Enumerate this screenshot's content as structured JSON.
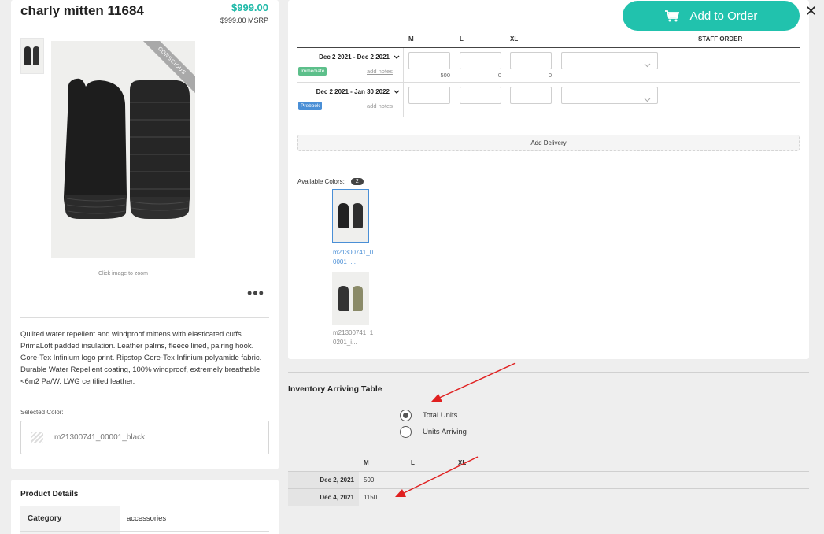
{
  "product": {
    "title": "charly mitten 11684",
    "price": "$999.00",
    "msrp": "$999.00 MSRP",
    "ribbon": "CONSCIOUS",
    "zoom_hint": "Click image to zoom",
    "more": "•••",
    "description": "Quilted water repellent and windproof mittens with elasticated cuffs. PrimaLoft padded insulation. Leather palms, fleece lined, pairing hook. Gore-Tex Infinium logo print. Ripstop Gore-Tex Infinium polyamide fabric. Durable Water Repellent coating, 100% windproof, extremely breathable <6m2 Pa/W. LWG certified leather.",
    "selected_color_label": "Selected Color:",
    "selected_color_value": "m21300741_00001_black"
  },
  "details": {
    "title": "Product Details",
    "rows": [
      {
        "key": "Category",
        "value": "accessories"
      }
    ]
  },
  "order": {
    "add_button": "Add to Order",
    "close": "✕",
    "sizes": [
      "M",
      "L",
      "XL"
    ],
    "staff_order_label": "STAFF ORDER",
    "deliveries": [
      {
        "date_range": "Dec 2 2021 - Dec 2 2021",
        "type": "Immediate",
        "notes": "add notes",
        "available": [
          "500",
          "0",
          "0"
        ]
      },
      {
        "date_range": "Dec 2 2021 - Jan 30 2022",
        "type": "Prebook",
        "notes": "add notes",
        "available": [
          "",
          "",
          ""
        ]
      }
    ],
    "add_delivery": "Add Delivery",
    "available_colors_label": "Available Colors:",
    "available_colors_count": "2",
    "colors": [
      {
        "name": "m21300741_00001_...",
        "selected": true
      },
      {
        "name": "m21300741_10201_i...",
        "selected": false
      }
    ]
  },
  "inventory": {
    "title": "Inventory Arriving Table",
    "options": [
      {
        "label": "Total Units",
        "checked": true
      },
      {
        "label": "Units Arriving",
        "checked": false
      }
    ],
    "columns": [
      "M",
      "L",
      "XL"
    ],
    "rows": [
      {
        "date": "Dec 2, 2021",
        "values": [
          "500",
          "",
          ""
        ]
      },
      {
        "date": "Dec 4, 2021",
        "values": [
          "1150",
          "",
          ""
        ]
      }
    ]
  },
  "colors": {
    "accent": "#21c2ad",
    "price": "#1fb9a8",
    "immediate": "#5cbf8a",
    "prebook": "#4a8fd6",
    "annotation": "#e02020"
  }
}
